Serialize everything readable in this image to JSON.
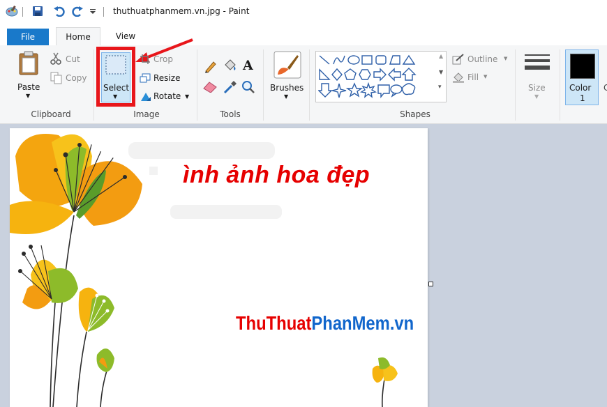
{
  "window": {
    "title": "thuthuatphanmem.vn.jpg - Paint",
    "quick_access": [
      "paint-app-icon",
      "save-icon",
      "undo-icon",
      "redo-icon",
      "customize-quick-access-icon"
    ]
  },
  "tabs": [
    {
      "label": "File",
      "active": false
    },
    {
      "label": "Home",
      "active": true
    },
    {
      "label": "View",
      "active": false
    }
  ],
  "ribbon": {
    "clipboard": {
      "paste": "Paste",
      "cut": "Cut",
      "copy": "Copy",
      "group": "Clipboard"
    },
    "image": {
      "select": "Select",
      "crop": "Crop",
      "resize": "Resize",
      "rotate": "Rotate",
      "group": "Image"
    },
    "tools": {
      "group": "Tools",
      "text_tool": "A"
    },
    "brushes": {
      "label": "Brushes"
    },
    "shapes": {
      "outline": "Outline",
      "fill": "Fill",
      "group": "Shapes"
    },
    "size": {
      "label": "Size"
    },
    "color1": {
      "label": "Color",
      "number": "1",
      "value": "#000000"
    }
  },
  "canvas": {
    "heading": "ình ảnh hoa đẹp",
    "watermark_part1": "ThuThuat",
    "watermark_part2": "PhanMem",
    "watermark_part3": ".vn"
  },
  "colors": {
    "accent": "#1979ca",
    "highlight_box": "#e8161b",
    "arrow": "#e8161b",
    "canvas_bg": "#c9d1de"
  }
}
